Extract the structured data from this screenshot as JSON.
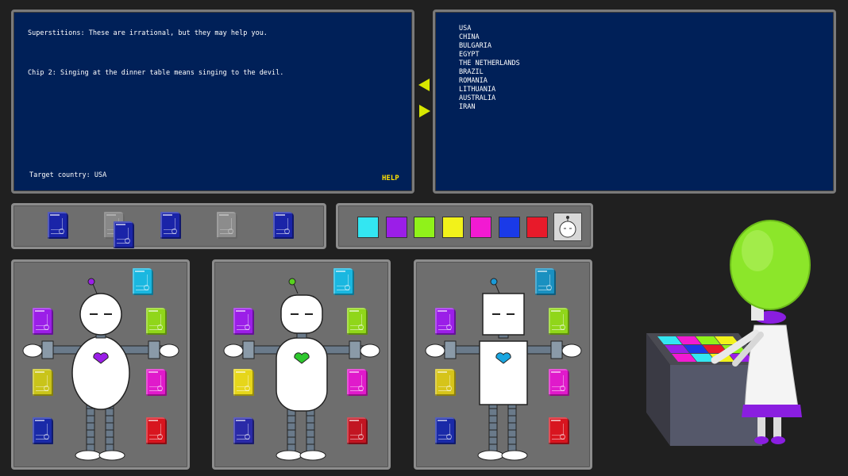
{
  "left_screen": {
    "intro": "Superstitions: These are irrational, but they may help you.",
    "chip_text": "Chip 2: Singing at the dinner table means singing to the devil.",
    "target": "Target country: USA",
    "help_label": "HELP"
  },
  "right_screen": {
    "countries": [
      "USA",
      "CHINA",
      "BULGARIA",
      "EGYPT",
      "THE NETHERLANDS",
      "BRAZIL",
      "ROMANIA",
      "LITHUANIA",
      "AUSTRALIA",
      "IRAN"
    ]
  },
  "arrows": {
    "up_color": "#d8e800",
    "down_color": "#d8e800"
  },
  "chip_tray": {
    "slots": [
      {
        "color": "#1a24a8",
        "state": "filled"
      },
      {
        "color": "#1a24a8",
        "state": "lifted"
      },
      {
        "color": "#1a24a8",
        "state": "filled"
      },
      {
        "color": "#8a8a8a",
        "state": "empty"
      },
      {
        "color": "#1a24a8",
        "state": "filled"
      }
    ]
  },
  "color_tray": {
    "colors": [
      "#33e6f2",
      "#9b1ee8",
      "#90f21a",
      "#f2f21a",
      "#f21ad2",
      "#1a3ae8",
      "#e81a2a"
    ],
    "robot_button_icon": "robot-head-icon"
  },
  "robots": [
    {
      "shape": "round",
      "accent": "#9b1ee8",
      "heart": "#9b1ee8",
      "chips": [
        "#1ab7e0",
        "#9b1ee8",
        "#90d61a",
        "#c9c41a",
        "#e01acb",
        "#1a2aa8",
        "#d8151f"
      ]
    },
    {
      "shape": "capsule",
      "accent": "#58d21e",
      "heart": "#2dc82d",
      "chips": [
        "#1ab7e0",
        "#9b1ee8",
        "#90d61a",
        "#e6d61a",
        "#e01acb",
        "#2a2aa8",
        "#c21522"
      ]
    },
    {
      "shape": "box",
      "accent": "#1a9ad8",
      "heart": "#1aa6e0",
      "chips": [
        "#1a90c0",
        "#9b1ee8",
        "#90d61a",
        "#d6c41a",
        "#e01acb",
        "#1a2aa8",
        "#d8151f"
      ]
    }
  ],
  "scientist": {
    "head_color": "#8ce62a",
    "robe_color": "#f4f4f4",
    "trim_color": "#8a1ee0"
  }
}
